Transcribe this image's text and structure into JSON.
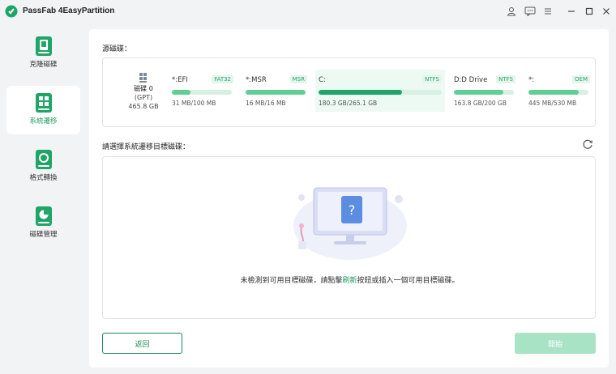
{
  "app": {
    "title": "PassFab 4EasyPartition"
  },
  "titlebar": {
    "icons": [
      "user-icon",
      "feedback-icon",
      "menu-icon",
      "minimize-icon",
      "maximize-icon",
      "close-icon"
    ]
  },
  "sidebar": {
    "items": [
      {
        "label": "克隆磁碟",
        "icon": "clone-disk-icon",
        "active": false
      },
      {
        "label": "系統遷移",
        "icon": "system-migration-icon",
        "active": true
      },
      {
        "label": "格式轉換",
        "icon": "format-convert-icon",
        "active": false
      },
      {
        "label": "磁碟管理",
        "icon": "disk-management-icon",
        "active": false
      }
    ]
  },
  "source": {
    "label": "源磁碟：",
    "disk": {
      "name": "磁碟 0",
      "style": "(GPT)",
      "size": "465.8 GB"
    },
    "partitions": [
      {
        "name": "*:EFI",
        "fs": "FAT32",
        "size": "31 MB/100 MB",
        "used_fraction": 0.31,
        "selected": false
      },
      {
        "name": "*:MSR",
        "fs": "MSR",
        "size": "16 MB/16 MB",
        "used_fraction": 1.0,
        "selected": false
      },
      {
        "name": "C:",
        "fs": "NTFS",
        "size": "180.3 GB/265.1 GB",
        "used_fraction": 0.68,
        "selected": true
      },
      {
        "name": "D:D Drive",
        "fs": "NTFS",
        "size": "163.8 GB/200 GB",
        "used_fraction": 0.82,
        "selected": false
      },
      {
        "name": "*:",
        "fs": "OEM",
        "size": "445 MB/530 MB",
        "used_fraction": 0.84,
        "selected": false
      }
    ]
  },
  "target": {
    "label": "請選擇系統遷移目標磁碟：",
    "empty_message_before": "未檢測到可用目標磁碟，請點擊",
    "empty_message_link": "刷新",
    "empty_message_after": "按鈕或插入一個可用目標磁碟。"
  },
  "buttons": {
    "back": "返回",
    "start": "開始"
  },
  "colors": {
    "accent": "#1d9a60",
    "bar_fill": "#5fcf95",
    "bar_track": "#d6f1e3",
    "start_disabled": "#a9e3c6"
  }
}
